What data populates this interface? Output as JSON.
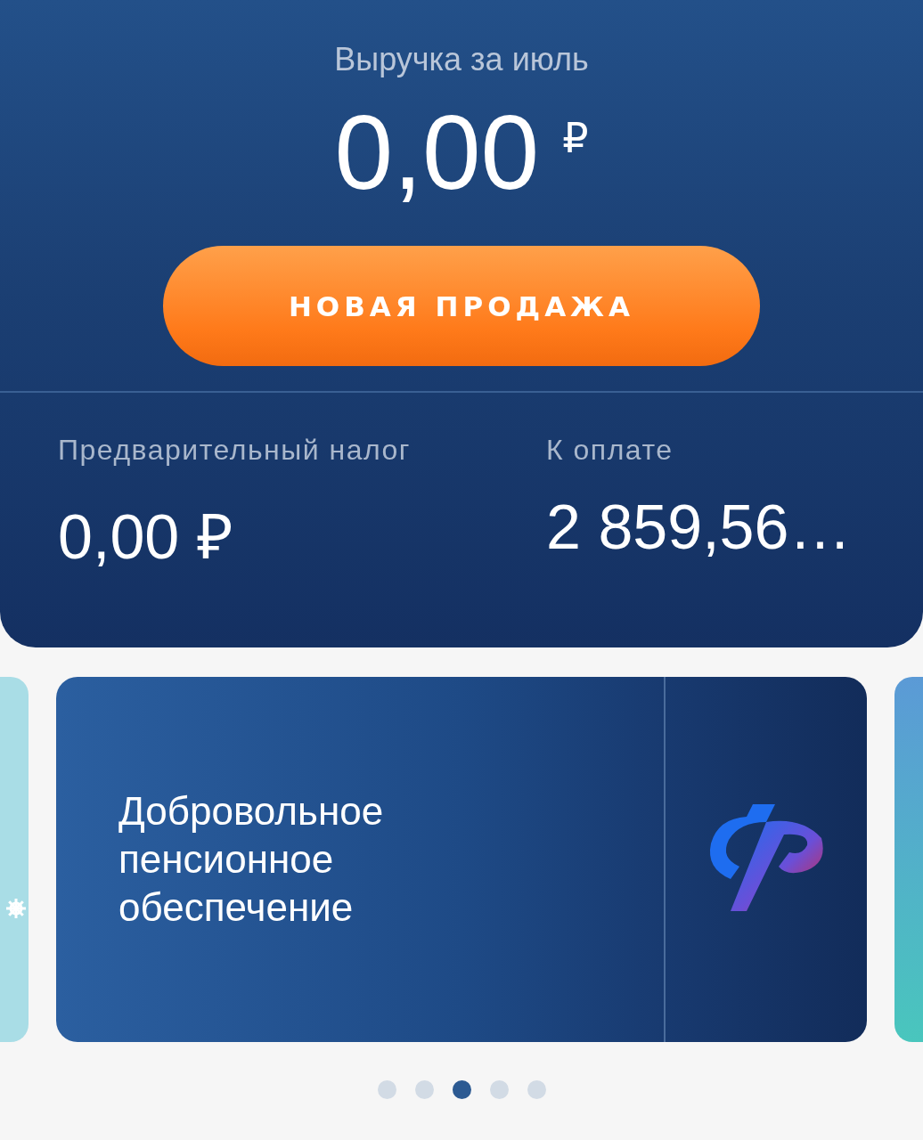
{
  "header": {
    "title": "Выручка за июль",
    "amount": "0,00",
    "currency": "₽",
    "button": "НОВАЯ ПРОДАЖА"
  },
  "summary": [
    {
      "label": "Предварительный налог",
      "value": "0,00 ₽"
    },
    {
      "label": "К оплате",
      "value": "2 859,56…"
    }
  ],
  "banner": {
    "text": "Добровольное пенсионное обеспечение"
  },
  "pager": [
    {
      "selected": false
    },
    {
      "selected": false
    },
    {
      "selected": true
    },
    {
      "selected": false
    },
    {
      "selected": false
    }
  ]
}
